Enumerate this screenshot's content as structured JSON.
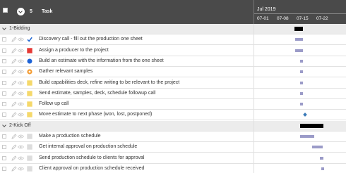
{
  "header": {
    "count": "5",
    "task_col": "Task",
    "month": "Jul 2019",
    "weeks": [
      "07-01",
      "07-08",
      "07-15",
      "07-22"
    ]
  },
  "groups": [
    {
      "label": "1-Bidding",
      "tasks": [
        {
          "name": "Discovery call - fill out the production one sheet",
          "status": "check-icon",
          "status_color": "#2a6dd4"
        },
        {
          "name": "Assign a producer to the project",
          "status": "square-icon",
          "status_color": "#e53935"
        },
        {
          "name": "Build an estimate with the information from the one sheet",
          "status": "circle-icon",
          "status_color": "#1e63d6"
        },
        {
          "name": "Gather relevant samples",
          "status": "gear-icon",
          "status_color": "#f39c34"
        },
        {
          "name": "Build capabilities deck, refine writing to be relevant to the project",
          "status": "square-icon",
          "status_color": "#f5d86a"
        },
        {
          "name": "Send estimate, samples, deck, schedule followup call",
          "status": "square-icon",
          "status_color": "#f5d86a"
        },
        {
          "name": "Follow up call",
          "status": "square-icon",
          "status_color": "#f5d86a"
        },
        {
          "name": "Move estimate to next phase (won, lost, postponed)",
          "status": "square-icon",
          "status_color": "#f5d86a"
        }
      ]
    },
    {
      "label": "2-Kick Off",
      "tasks": [
        {
          "name": "Make a production schedule",
          "status": "square-icon",
          "status_color": "#dcdcdc"
        },
        {
          "name": "Get internal approval on production schedule",
          "status": "square-icon",
          "status_color": "#dcdcdc"
        },
        {
          "name": "Send production schedule to clients for approval",
          "status": "square-icon",
          "status_color": "#dcdcdc"
        },
        {
          "name": "Client approval on production schedule received",
          "status": "square-icon",
          "status_color": "#dcdcdc"
        }
      ]
    }
  ]
}
